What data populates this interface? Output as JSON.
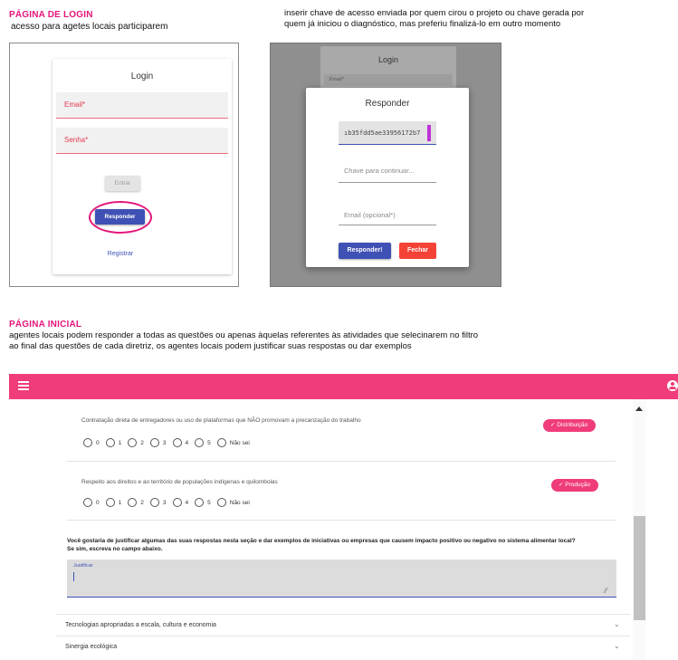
{
  "login_section": {
    "heading": "PÁGINA DE LOGIN",
    "subtitle": "acesso para agetes locais participarem",
    "note_line1": "inserir chave de acesso enviada por quem cirou o projeto ou chave gerada por",
    "note_line2": "quem já iniciou o diagnóstico, mas preferiu finalizá-lo em outro momento"
  },
  "login_card": {
    "title": "Login",
    "email_label": "Email*",
    "password_label": "Senha*",
    "enter_button": "Entrar",
    "respond_button": "Responder",
    "register_link": "Registrar"
  },
  "modal_background": {
    "title": "Login",
    "email_label": "Email*"
  },
  "respond_modal": {
    "title": "Responder",
    "key_value": "ıb35fdd5ae33956172b7",
    "continue_placeholder": "Chave para continuar...",
    "email_placeholder": "Email (opcional*)",
    "respond_button": "Responder!",
    "close_button": "Fechar"
  },
  "home_section": {
    "heading": "PÁGINA INICIAL",
    "line1": "agentes locais podem responder a todas as questões ou apenas àquelas referentes às atividades que selecinarem no filtro",
    "line2": "ao final das questões de cada diretriz, os agentes locais podem justificar suas respostas ou dar exemplos"
  },
  "app": {
    "colors": {
      "accent": "#f03c7a",
      "primary": "#3f51b5",
      "danger": "#f44336",
      "highlight": "#e5157a"
    },
    "menu_icon": "hamburger-icon",
    "account_icon": "account-circle-icon",
    "questions": [
      {
        "text": "Contratação direta de entregadores ou uso de plataformas que NÃO promovam a precarização do trabalho",
        "chip": "Distribuição",
        "options": [
          "0",
          "1",
          "2",
          "3",
          "4",
          "5",
          "Não sei"
        ]
      },
      {
        "text": "Respeito aos direitos e ao território de populações indígenas e quilombolas",
        "chip": "Produção",
        "options": [
          "0",
          "1",
          "2",
          "3",
          "4",
          "5",
          "Não sei"
        ]
      }
    ],
    "justify_question_line1": "Você gostaria de justificar algumas das suas respostas nesta seção e dar exemplos de iniciativas ou empresas que causem impacto positivo ou negativo no sistema alimentar local?",
    "justify_question_line2": "Se sim, escreva no campo abaixo.",
    "justify_label": "Justificar",
    "accordion": [
      "Tecnologias apropriadas a escala, cultura e economia",
      "Sinergia ecológica"
    ]
  }
}
